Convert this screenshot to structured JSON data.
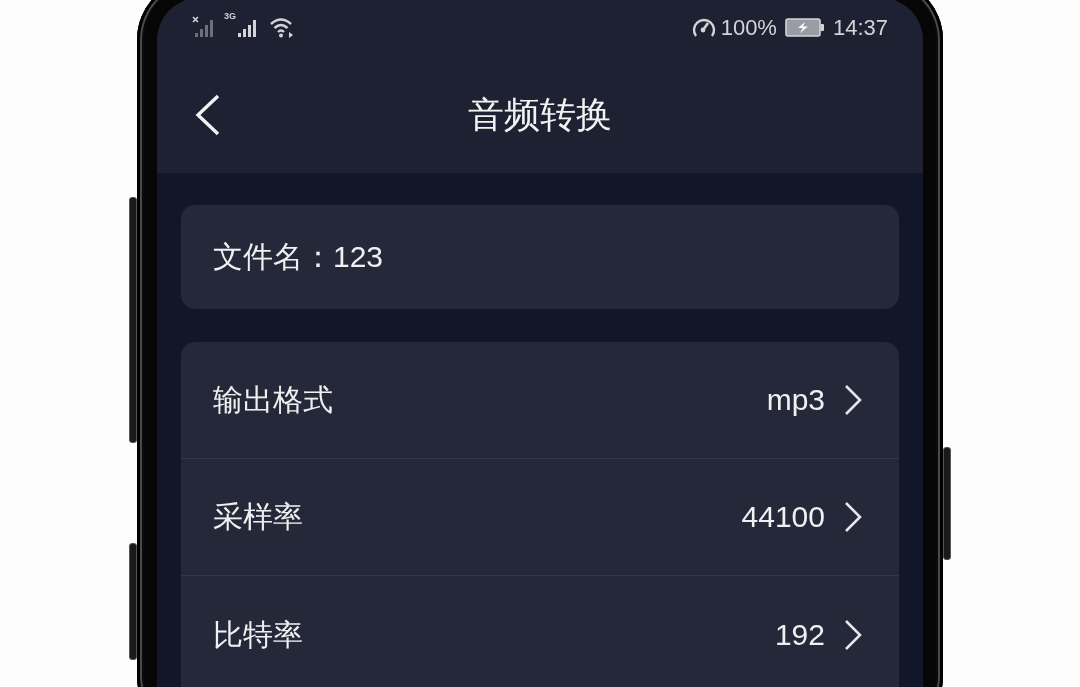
{
  "status_bar": {
    "network": "3G",
    "battery": "100%",
    "time": "14:37"
  },
  "header": {
    "title": "音频转换"
  },
  "file_card": {
    "text": "文件名：123"
  },
  "settings": [
    {
      "label": "输出格式",
      "value": "mp3"
    },
    {
      "label": "采样率",
      "value": "44100"
    },
    {
      "label": "比特率",
      "value": "192"
    }
  ]
}
